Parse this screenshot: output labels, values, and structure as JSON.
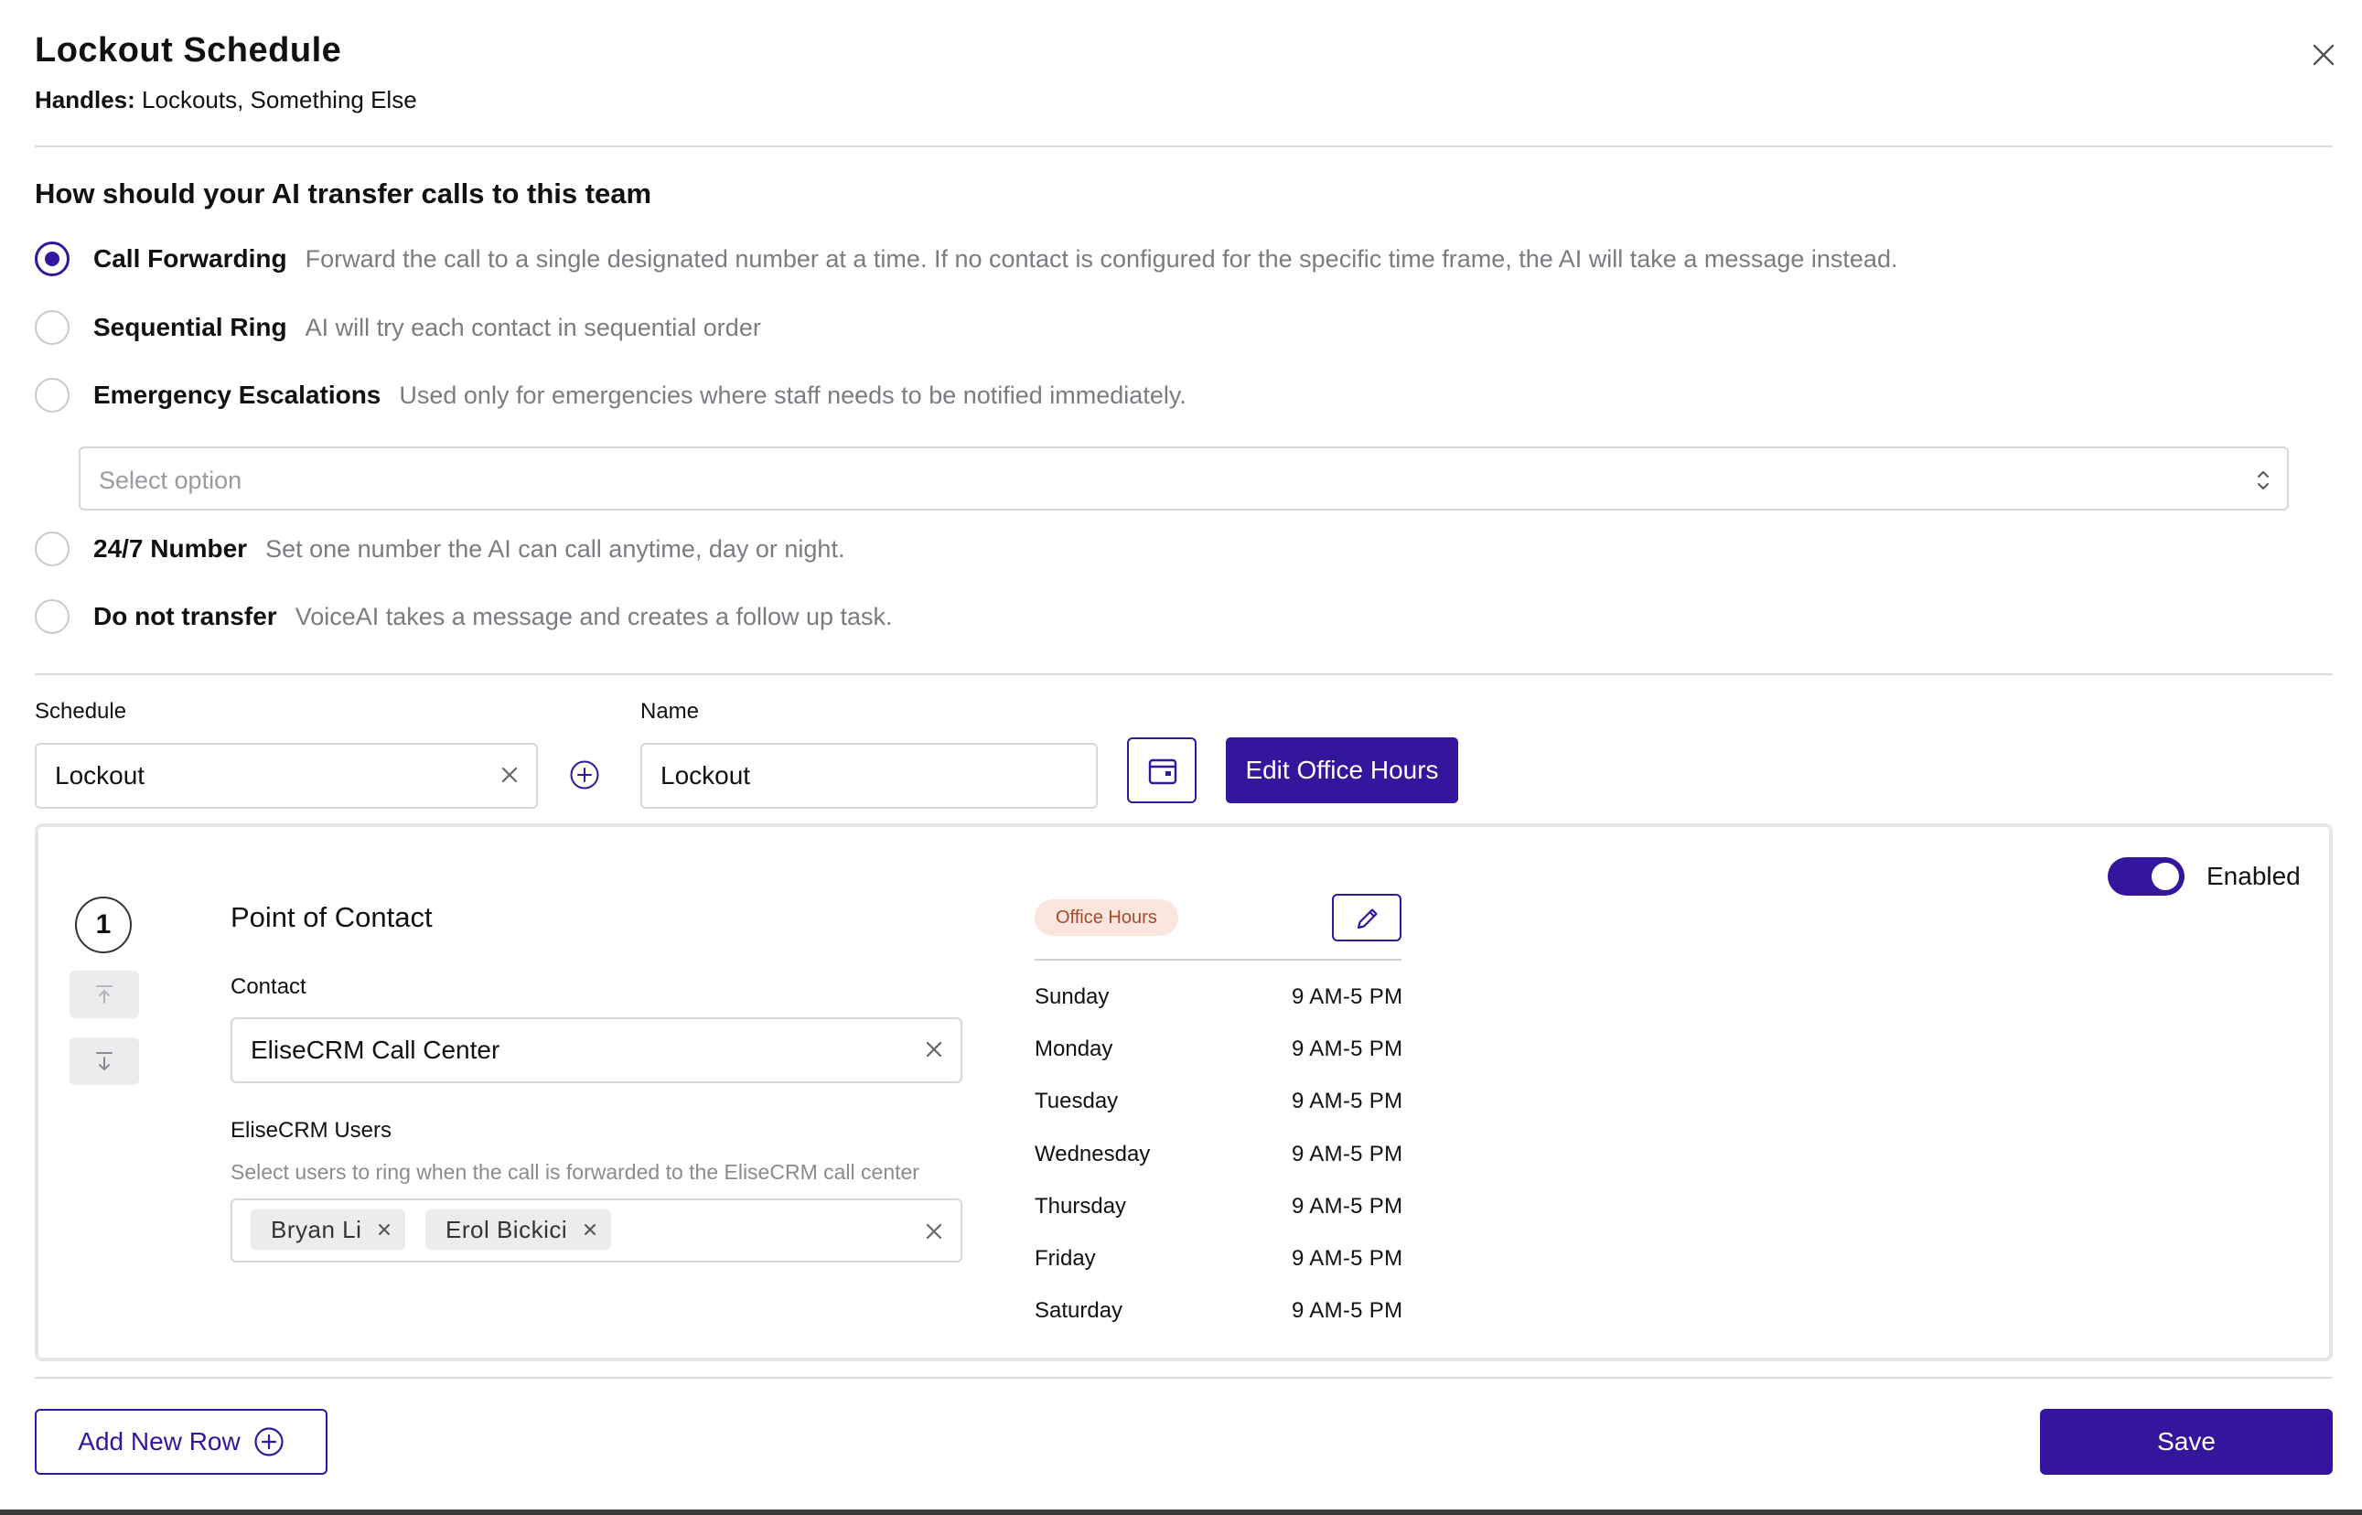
{
  "header": {
    "title": "Lockout Schedule",
    "handles_label": "Handles:",
    "handles_value": "Lockouts, Something Else"
  },
  "transfer": {
    "question": "How should your AI transfer calls to this team",
    "options": [
      {
        "title": "Call Forwarding",
        "desc": "Forward the call to a single designated number at a time. If no contact is configured for the specific time frame, the AI will take a message instead.",
        "selected": true
      },
      {
        "title": "Sequential Ring",
        "desc": "AI will try each contact in sequential order",
        "selected": false
      },
      {
        "title": "Emergency Escalations",
        "desc": "Used only for emergencies where staff needs to be notified immediately.",
        "selected": false
      },
      {
        "title": "24/7 Number",
        "desc": "Set one number the AI can call anytime, day or night.",
        "selected": false
      },
      {
        "title": "Do not transfer",
        "desc": "VoiceAI takes a message and creates a follow up task.",
        "selected": false
      }
    ],
    "select_placeholder": "Select option"
  },
  "schedule": {
    "schedule_label": "Schedule",
    "schedule_value": "Lockout",
    "name_label": "Name",
    "name_value": "Lockout",
    "edit_hours_label": "Edit Office Hours"
  },
  "contact_card": {
    "step_number": "1",
    "title": "Point of Contact",
    "contact_label": "Contact",
    "contact_value": "EliseCRM Call Center",
    "users_label": "EliseCRM Users",
    "users_hint": "Select users to ring when the call is forwarded to the EliseCRM call center",
    "users": [
      "Bryan Li",
      "Erol Bickici"
    ],
    "hours_badge": "Office Hours",
    "enabled_label": "Enabled",
    "enabled": true,
    "hours": [
      {
        "day": "Sunday",
        "time": "9 AM-5 PM"
      },
      {
        "day": "Monday",
        "time": "9 AM-5 PM"
      },
      {
        "day": "Tuesday",
        "time": "9 AM-5 PM"
      },
      {
        "day": "Wednesday",
        "time": "9 AM-5 PM"
      },
      {
        "day": "Thursday",
        "time": "9 AM-5 PM"
      },
      {
        "day": "Friday",
        "time": "9 AM-5 PM"
      },
      {
        "day": "Saturday",
        "time": "9 AM-5 PM"
      }
    ]
  },
  "footer": {
    "add_row_label": "Add New Row",
    "save_label": "Save"
  },
  "colors": {
    "accent": "#34169c",
    "badge_bg": "#fbe6dd",
    "badge_text": "#a44a2e"
  }
}
